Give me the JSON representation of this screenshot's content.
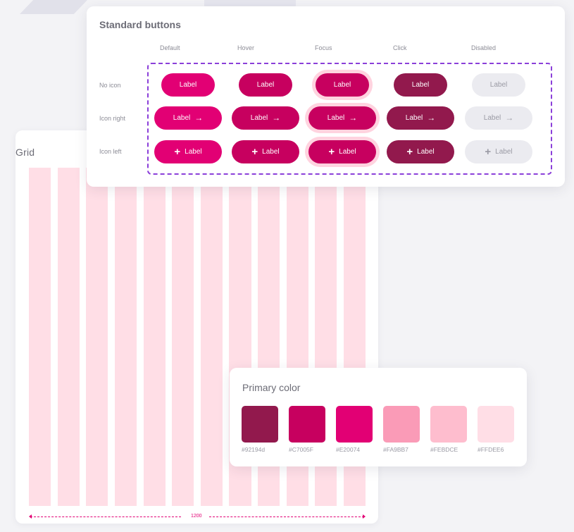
{
  "grid": {
    "title": "Grid",
    "column_count": 12,
    "column_color": "#FFDEE6",
    "width_label": "1200",
    "measure_color": "#E20074"
  },
  "buttons": {
    "title": "Standard buttons",
    "columns": [
      "Default",
      "Hover",
      "Focus",
      "Click",
      "Disabled"
    ],
    "rows": [
      "No icon",
      "Icon right",
      "Icon left"
    ],
    "label": "Label",
    "icons": {
      "arrow": "arrow-right-icon",
      "plus": "plus-icon"
    },
    "state_colors": {
      "default": "#E20074",
      "hover": "#C7005F",
      "focus": "#C7005F",
      "focus_ring": "#FFD3DF",
      "click": "#92194D",
      "disabled": "#EBEBF0",
      "disabled_text": "#9A9AA4"
    },
    "boundary_color": "#8B3FD9"
  },
  "primary_color": {
    "title": "Primary color",
    "swatches": [
      {
        "label": "#92194d",
        "hex": "#92194d"
      },
      {
        "label": "#C7005F",
        "hex": "#C7005F"
      },
      {
        "label": "#E20074",
        "hex": "#E20074"
      },
      {
        "label": "#FA9BB7",
        "hex": "#FA9BB7"
      },
      {
        "label": "#FEBDCE",
        "hex": "#FEBDCE"
      },
      {
        "label": "#FFDEE6",
        "hex": "#FFDEE6"
      }
    ]
  }
}
